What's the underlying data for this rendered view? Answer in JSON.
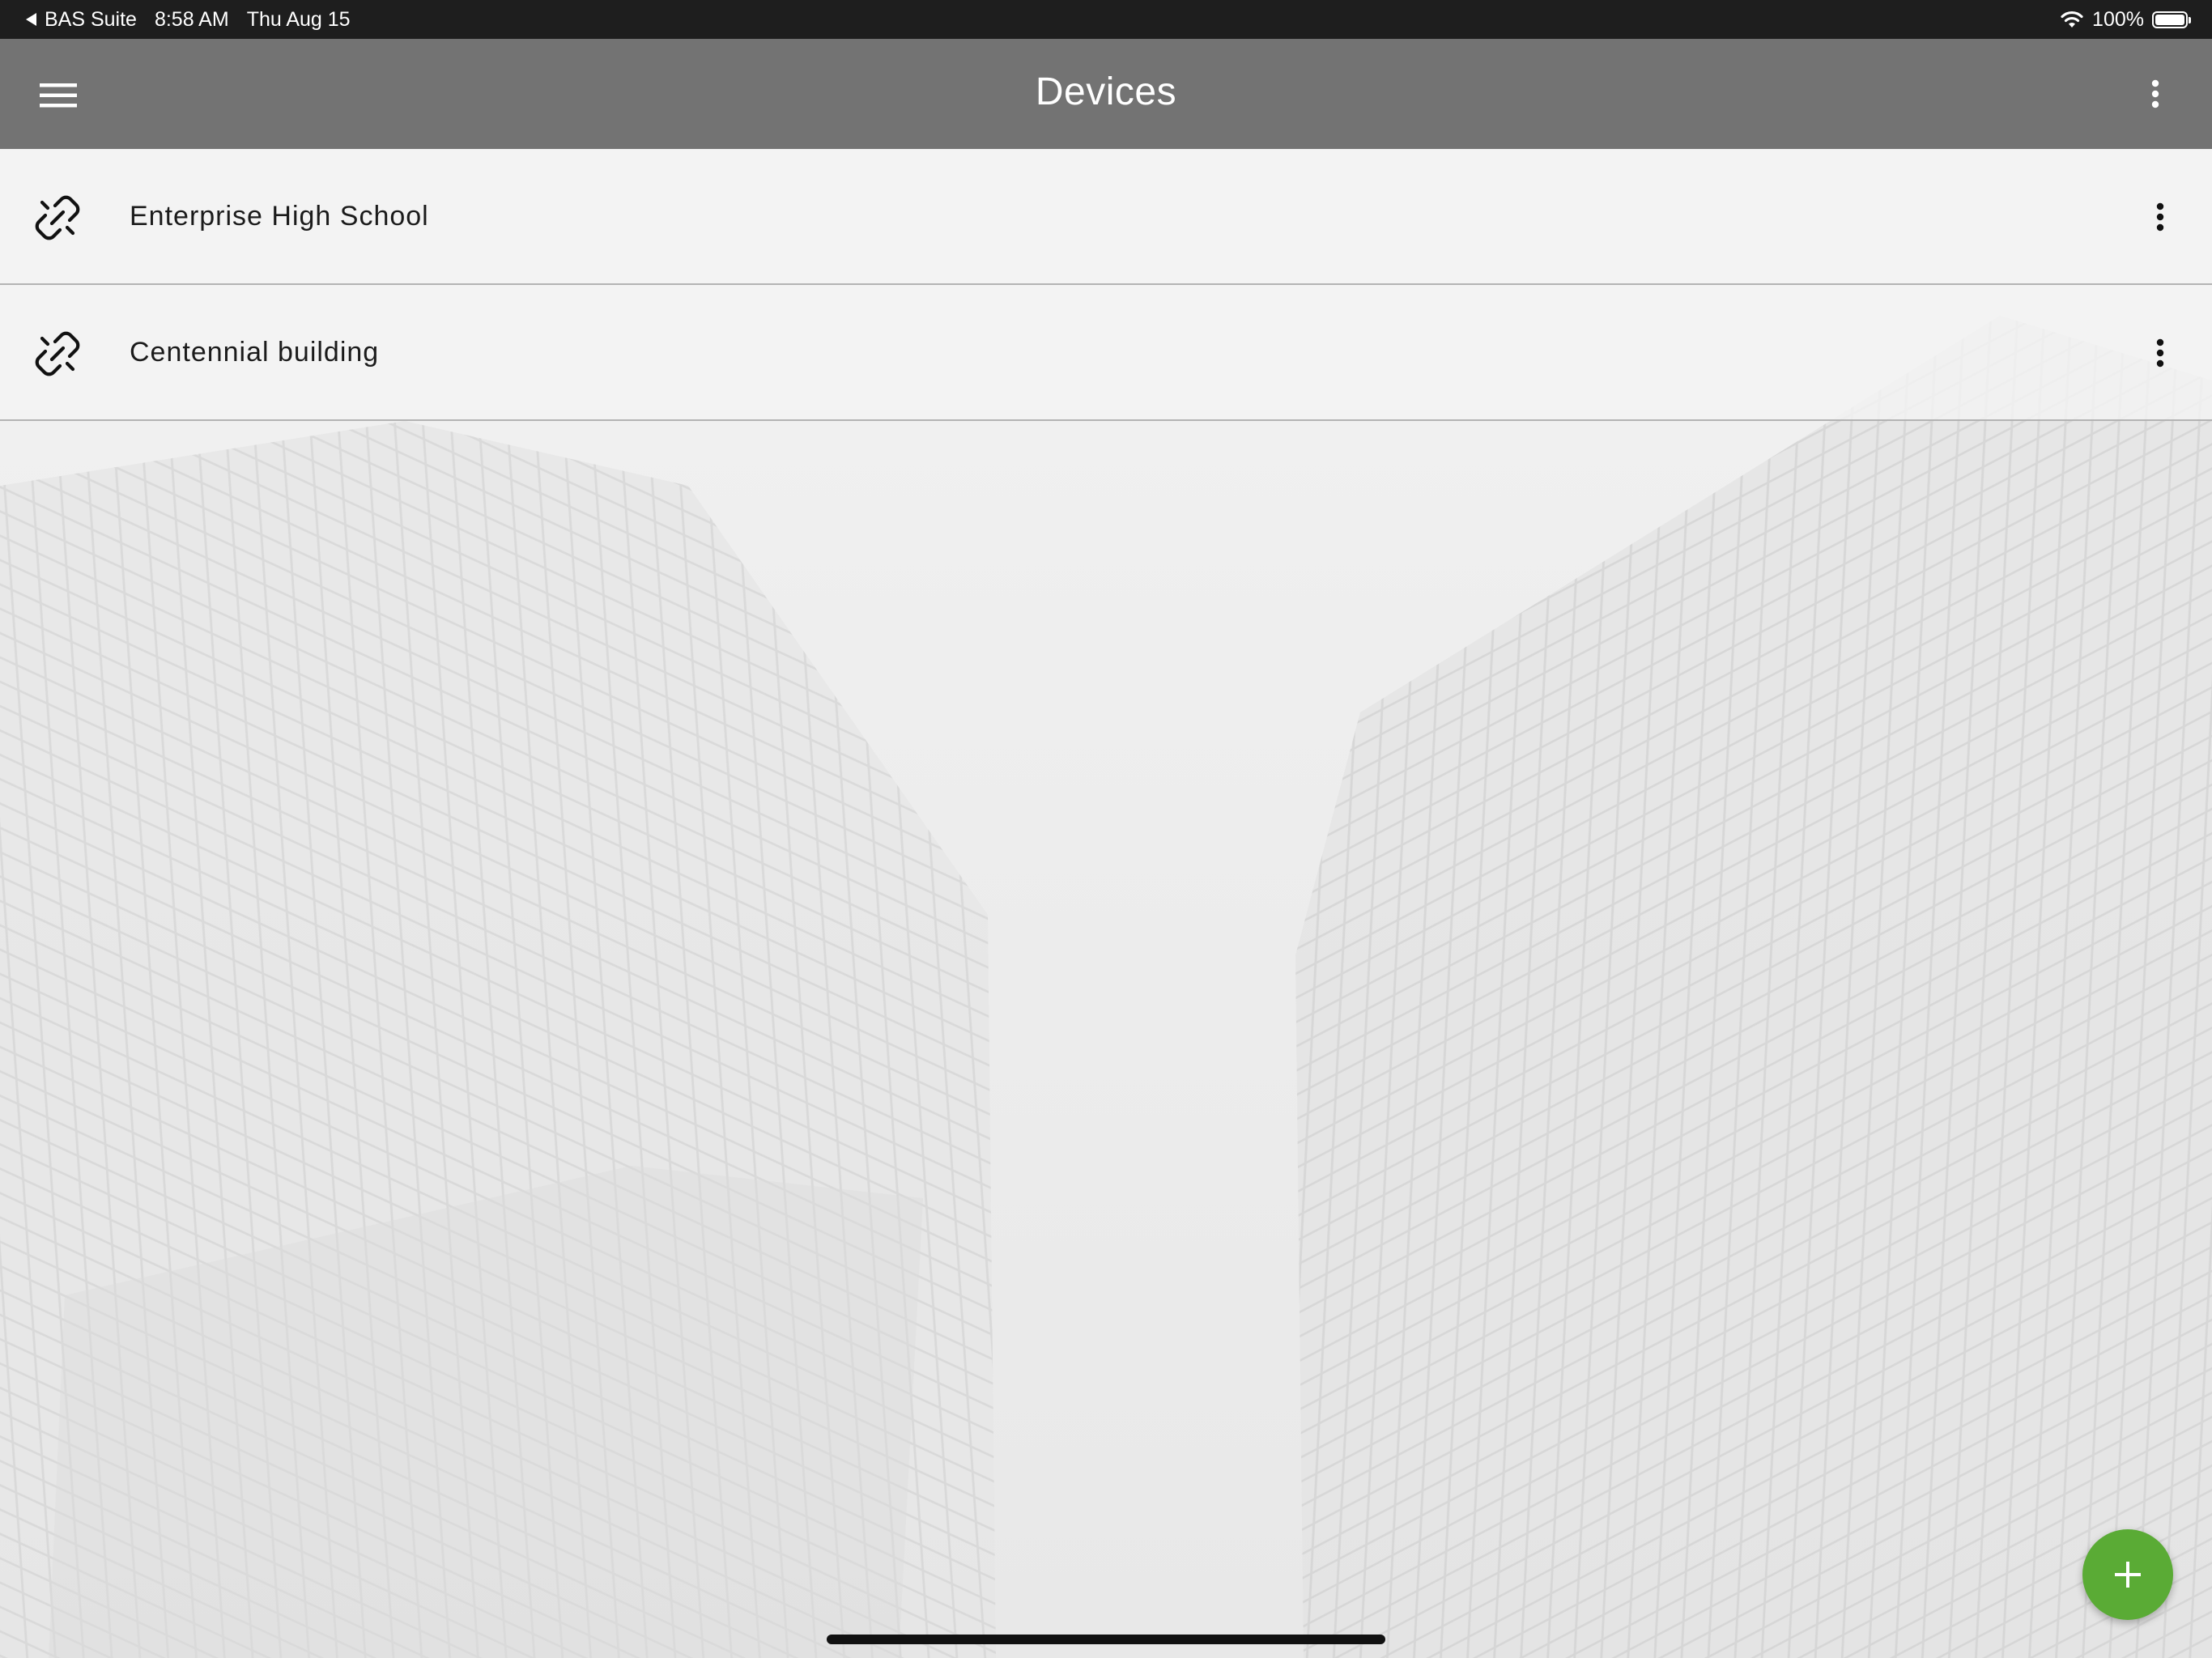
{
  "status_bar": {
    "back_app": "BAS Suite",
    "time": "8:58 AM",
    "date": "Thu Aug 15",
    "battery": "100%",
    "battery_level": 1.0,
    "icons": [
      "back-arrow-icon",
      "wifi-icon",
      "battery-icon"
    ]
  },
  "app_bar": {
    "title": "Devices",
    "icons": [
      "hamburger-menu-icon",
      "more-vert-icon"
    ],
    "color": "#737373"
  },
  "devices": [
    {
      "name": "Enterprise High School",
      "icon": "link-icon"
    },
    {
      "name": "Centennial building",
      "icon": "link-icon"
    }
  ],
  "fab": {
    "icon": "plus-icon",
    "color": "#5aab35"
  }
}
